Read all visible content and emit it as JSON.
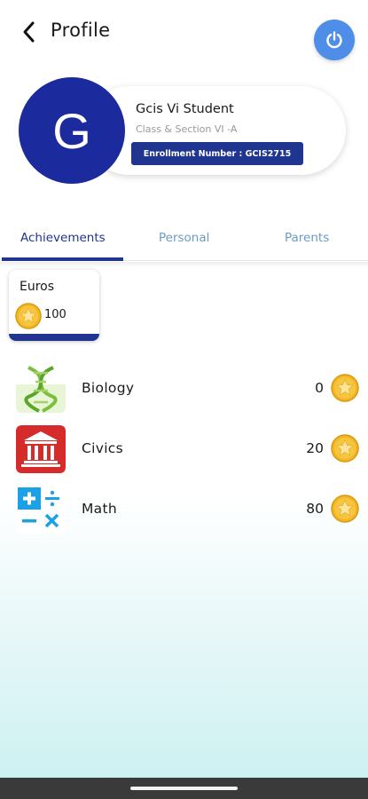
{
  "header": {
    "title": "Profile",
    "back_icon": "chevron-left-icon",
    "power_icon": "power-icon",
    "power_color": "#4f8ee8"
  },
  "profile": {
    "avatar_initial": "G",
    "avatar_color": "#1b2a9c",
    "name": "Gcis Vi Student",
    "class_section": "Class & Section VI -A",
    "enrollment": "Enrollment Number : GCIS2715"
  },
  "tabs": [
    {
      "label": "Achievements",
      "active": true
    },
    {
      "label": "Personal",
      "active": false
    },
    {
      "label": "Parents",
      "active": false
    }
  ],
  "euros": {
    "label": "Euros",
    "value": "100",
    "icon": "star-coin-icon"
  },
  "subjects": [
    {
      "name": "Biology",
      "score": "0",
      "icon": "dna-icon"
    },
    {
      "name": "Civics",
      "score": "20",
      "icon": "courthouse-icon"
    },
    {
      "name": "Math",
      "score": "80",
      "icon": "math-operators-icon"
    }
  ],
  "colors": {
    "primary": "#1f3590",
    "tab_inactive": "#6b9bc6",
    "coin": "#f2b625"
  }
}
